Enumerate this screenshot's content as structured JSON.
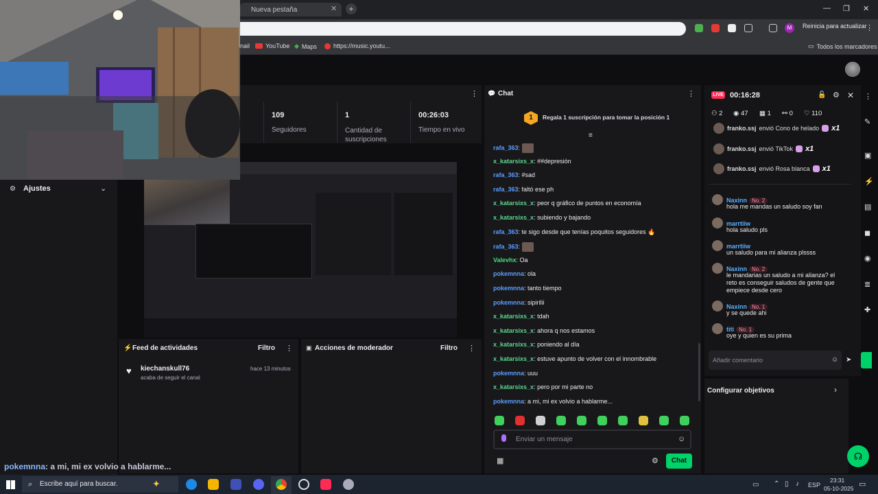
{
  "browser": {
    "tab_title": "Nueva pestaña",
    "update_label": "Reinicia para actualizar",
    "profile_letter": "M",
    "bookmarks": [
      {
        "label": "nail",
        "icon": "mail-icon"
      },
      {
        "label": "YouTube",
        "icon": "youtube-icon"
      },
      {
        "label": "Maps",
        "icon": "maps-icon"
      },
      {
        "label": "https://music.youtu...",
        "icon": "music-icon"
      }
    ],
    "all_bookmarks": "Todos los marcadores"
  },
  "stats": [
    {
      "value": "109",
      "label": "Seguidores"
    },
    {
      "value": "1",
      "label": "Cantidad de suscripciones"
    },
    {
      "value": "00:26:03",
      "label": "Tiempo en vivo"
    }
  ],
  "settings": {
    "label": "Ajustes"
  },
  "activity_feed": {
    "title": "Feed de actividades",
    "filter": "Filtro",
    "items": [
      {
        "user": "kiechanskull76",
        "action": "acaba de seguir el canal",
        "time": "hace 13 minutos"
      }
    ]
  },
  "mod_actions": {
    "title": "Acciones de moderador",
    "filter": "Filtro"
  },
  "overlay_chat": {
    "user": "pokemnna",
    "text": ": a mi, mi ex volvio a hablarme..."
  },
  "chat": {
    "title": "Chat",
    "gift_banner": "Regala 1 suscripción para tomar la posición 1",
    "gift_rank": "1",
    "messages": [
      {
        "user": "rafa_363",
        "text": ":",
        "color": "blue",
        "emote": true
      },
      {
        "user": "x_katarsixs_x",
        "text": ": ##depresión",
        "color": "green"
      },
      {
        "user": "rafa_363",
        "text": ": #sad",
        "color": "blue"
      },
      {
        "user": "rafa_363",
        "text": ": faltó ese ph",
        "color": "blue"
      },
      {
        "user": "x_katarsixs_x",
        "text": ": peor q gráfico de puntos en economía",
        "color": "green"
      },
      {
        "user": "x_katarsixs_x",
        "text": ": subiendo y bajando",
        "color": "green"
      },
      {
        "user": "rafa_363",
        "text": ": te sigo desde que tenías poquitos seguidores 🔥",
        "color": "blue"
      },
      {
        "user": "rafa_363",
        "text": ":",
        "color": "blue",
        "emote": true
      },
      {
        "user": "Valevhx",
        "text": ": Oa",
        "color": "lime"
      },
      {
        "user": "pokemnna",
        "text": ": ola",
        "color": "blue"
      },
      {
        "user": "pokemnna",
        "text": ": tanto tiempo",
        "color": "blue"
      },
      {
        "user": "pokemnna",
        "text": ": sipirilii",
        "color": "blue"
      },
      {
        "user": "x_katarsixs_x",
        "text": ": tdah",
        "color": "green"
      },
      {
        "user": "x_katarsixs_x",
        "text": ": ahora q nos estamos",
        "color": "green"
      },
      {
        "user": "x_katarsixs_x",
        "text": ": poniendo al día",
        "color": "green"
      },
      {
        "user": "x_katarsixs_x",
        "text": ": estuve apunto de volver con el innombrable",
        "color": "green"
      },
      {
        "user": "pokemnna",
        "text": ": uuu",
        "color": "blue"
      },
      {
        "user": "x_katarsixs_x",
        "text": ": pero por mi parte no",
        "color": "green"
      },
      {
        "user": "pokemnna",
        "text": ": a mi, mi ex volvio a hablarme...",
        "color": "blue"
      }
    ],
    "input_placeholder": "Enviar un mensaje",
    "send_label": "Chat"
  },
  "live": {
    "badge": "LIVE",
    "timer": "00:16:28",
    "stats": [
      {
        "icon": "users-icon",
        "value": "2"
      },
      {
        "icon": "eye-icon",
        "value": "47"
      },
      {
        "icon": "gift-icon",
        "value": "1"
      },
      {
        "icon": "share-icon",
        "value": "0"
      },
      {
        "icon": "heart-icon",
        "value": "110"
      }
    ],
    "gifts": [
      {
        "user": "franko.ssj",
        "text": "envió Cono de helado",
        "count": "x1"
      },
      {
        "user": "franko.ssj",
        "text": "envió TikTok",
        "count": "x1"
      },
      {
        "user": "franko.ssj",
        "text": "envió Rosa blanca",
        "count": "x1"
      }
    ],
    "comments": [
      {
        "user": "Naxinn",
        "badge": "No. 2",
        "text": "hola me mandas un saludo soy fan"
      },
      {
        "user": "marrtiiw",
        "badge": "",
        "text": "hola saludo pls"
      },
      {
        "user": "marrtiiw",
        "badge": "",
        "text": "un saludo para mi alianza plssss"
      },
      {
        "user": "Naxinn",
        "badge": "No. 2",
        "text": "le mandarias un saludo a mi alianza? el reto es conseguir saludos de gente que empiece desde cero"
      },
      {
        "user": "Naxinn",
        "badge": "No. 1",
        "text": "y se quede ahi"
      },
      {
        "user": "titi",
        "badge": "No. 1",
        "text": "oye y quien es su prima"
      }
    ],
    "comment_placeholder": "Añadir comentario"
  },
  "objectives": {
    "label": "Configurar objetivos"
  },
  "taskbar": {
    "search_placeholder": "Escribe aquí para buscar.",
    "lang": "ESP",
    "time": "23:31",
    "date": "05-10-2025"
  },
  "colors": {
    "accent_green": "#00f593",
    "twitch_purple": "#9147ff",
    "live_red": "#fe2c55"
  }
}
